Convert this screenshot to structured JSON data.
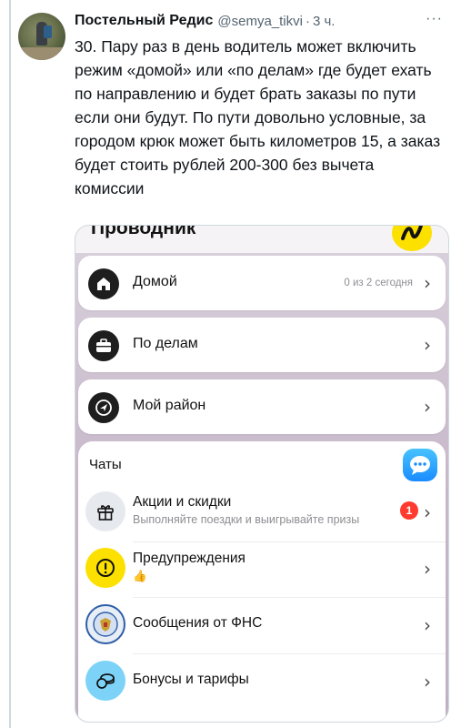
{
  "tweet": {
    "author_name": "Постельный Редис",
    "handle": "@semya_tikvi",
    "separator": "·",
    "time": "3 ч.",
    "more": "···",
    "text": "30. Пару раз в день водитель может включить режим «домой» или «по делам» где будет ехать по направлению и будет брать заказы по пути если они будут. По пути довольно условные, за городом крюк может быть километров 15, а заказ будет стоить рублей 200-300 без вычета комиссии"
  },
  "app": {
    "section_title": "Проводник",
    "modes": [
      {
        "label": "Домой",
        "meta": "0 из 2 сегодня",
        "icon": "house-icon"
      },
      {
        "label": "По делам",
        "meta": "",
        "icon": "briefcase-icon"
      },
      {
        "label": "Мой район",
        "meta": "",
        "icon": "navigation-arrow-icon"
      }
    ],
    "chats": {
      "title": "Чаты",
      "items": [
        {
          "label": "Акции и скидки",
          "sub": "Выполняйте поездки и выигрывайте призы",
          "badge": "1",
          "icon": "gift-icon"
        },
        {
          "label": "Предупреждения",
          "sub": "👍",
          "icon": "warning-icon"
        },
        {
          "label": "Сообщения от ФНС",
          "sub": "",
          "icon": "fns-emblem-icon"
        },
        {
          "label": "Бонусы и тарифы",
          "sub": "",
          "icon": "coins-icon"
        }
      ]
    },
    "chevron": "›"
  },
  "colors": {
    "accent_yellow": "#fce000",
    "badge_red": "#ff3b30",
    "chat_blue": "#1a8cff"
  }
}
